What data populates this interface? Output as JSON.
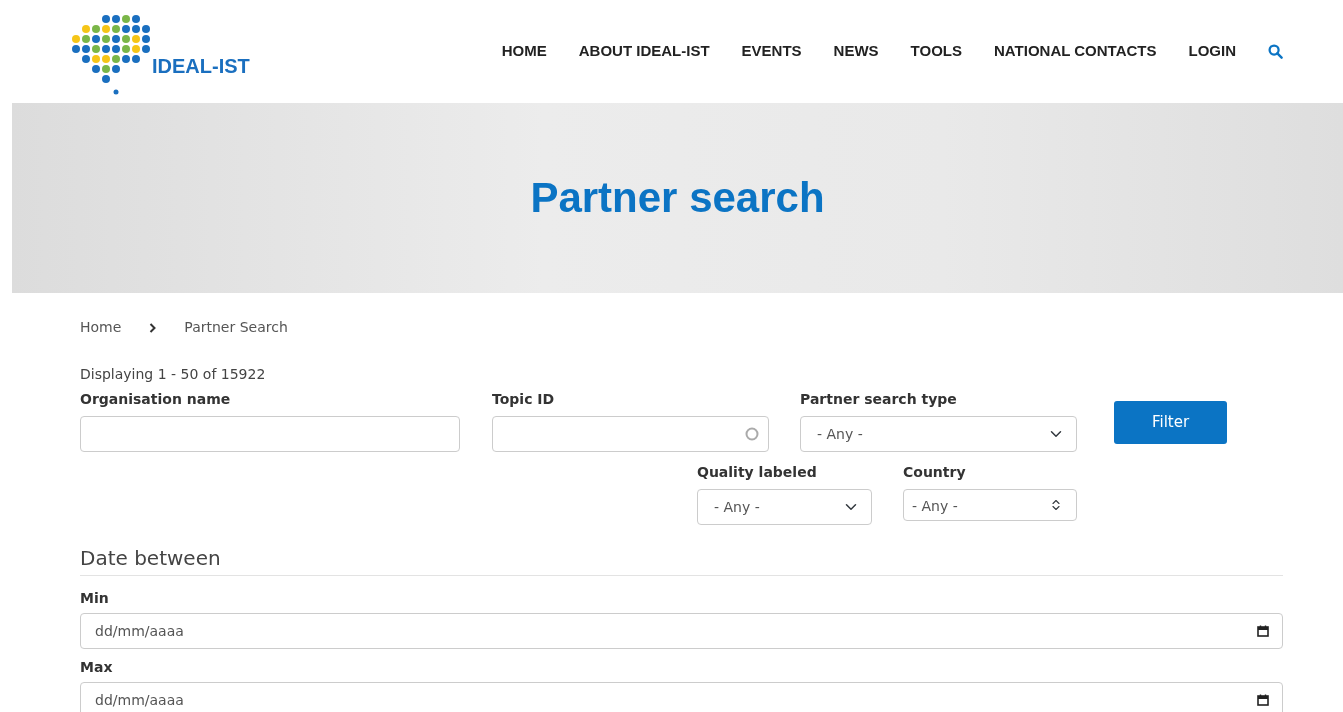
{
  "header": {
    "logo_text": "IDEAL-IST",
    "nav": [
      {
        "label": "HOME"
      },
      {
        "label": "ABOUT IDEAL-IST"
      },
      {
        "label": "EVENTS"
      },
      {
        "label": "NEWS"
      },
      {
        "label": "TOOLS"
      },
      {
        "label": "NATIONAL CONTACTS"
      },
      {
        "label": "LOGIN"
      }
    ]
  },
  "banner": {
    "title": "Partner search"
  },
  "breadcrumb": [
    "Home",
    "Partner Search"
  ],
  "result_summary": "Displaying 1 - 50 of 15922",
  "filters": [
    {
      "kind": "text",
      "label": "Organisation name"
    },
    {
      "kind": "search",
      "label": "Topic ID"
    },
    {
      "kind": "select",
      "label": "Partner search type",
      "value": "- Any -"
    },
    {
      "kind": "select",
      "label": "Quality labeled",
      "value": "- Any -"
    },
    {
      "kind": "listbox",
      "label": "Country",
      "value": "- Any -"
    }
  ],
  "filter_button": "Filter",
  "date_section": {
    "title": "Date between",
    "fields": [
      {
        "label": "Min",
        "placeholder": "dd/mm/aaaa"
      },
      {
        "label": "Max",
        "placeholder": "dd/mm/aaaa"
      }
    ]
  }
}
